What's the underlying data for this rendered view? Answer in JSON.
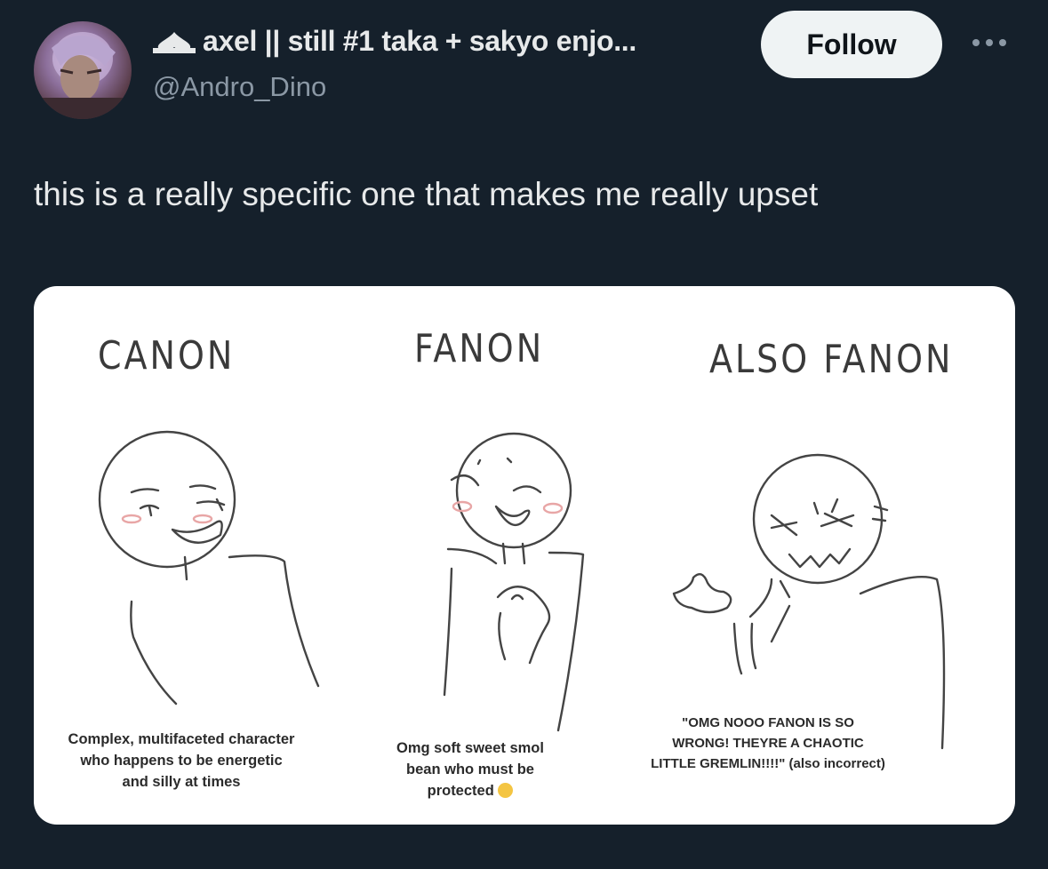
{
  "author": {
    "display_name": "axel || still #1 taka + sakyo enjo...",
    "handle": "@Andro_Dino",
    "avatar_icon": "profile-avatar",
    "badge_icon": "spade-icon"
  },
  "follow_label": "Follow",
  "more_icon": "more-options-icon",
  "tweet_text": "this is a really specific one that makes me really upset",
  "media": {
    "panels": [
      {
        "heading": "CANON",
        "caption_lines": [
          "Complex, multifaceted character",
          "who happens to be energetic",
          "and silly at times"
        ]
      },
      {
        "heading": "FANON",
        "caption_lines": [
          "Omg soft sweet smol",
          "bean who must be",
          "protected"
        ]
      },
      {
        "heading": "ALSO FANON",
        "caption_lines": [
          "\"OMG NOOO FANON IS SO",
          "WRONG! THEYRE A CHAOTIC",
          "LITTLE GREMLIN!!!!\" (also incorrect)"
        ]
      }
    ]
  },
  "colors": {
    "background": "#15202b",
    "text": "#e7e9ea",
    "muted": "#8b98a5",
    "follow_bg": "#eff3f4"
  }
}
